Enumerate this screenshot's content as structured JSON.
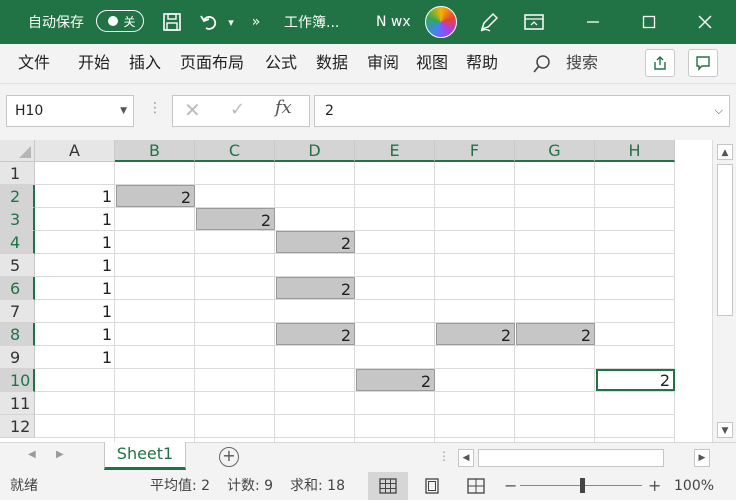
{
  "titlebar": {
    "autosave_label": "自动保存",
    "autosave_state": "关",
    "more_commands": "»",
    "doc_title": "工作簿...",
    "user_name": "N wx"
  },
  "menu": {
    "items": [
      "文件",
      "开始",
      "插入",
      "页面布局",
      "公式",
      "数据",
      "审阅",
      "视图",
      "帮助"
    ],
    "search_label": "搜索"
  },
  "formula_bar": {
    "name_box": "H10",
    "fx_label": "fx",
    "formula": "2"
  },
  "grid": {
    "columns": [
      "A",
      "B",
      "C",
      "D",
      "E",
      "F",
      "G",
      "H"
    ],
    "rows": [
      "1",
      "2",
      "3",
      "4",
      "5",
      "6",
      "7",
      "8",
      "9",
      "10",
      "11",
      "12"
    ],
    "active_cell": "H10",
    "cells": [
      {
        "ref": "A2",
        "value": "1"
      },
      {
        "ref": "A3",
        "value": "1"
      },
      {
        "ref": "A4",
        "value": "1"
      },
      {
        "ref": "A5",
        "value": "1"
      },
      {
        "ref": "A6",
        "value": "1"
      },
      {
        "ref": "A7",
        "value": "1"
      },
      {
        "ref": "A8",
        "value": "1"
      },
      {
        "ref": "A9",
        "value": "1"
      },
      {
        "ref": "B2",
        "value": "2",
        "highlight": true
      },
      {
        "ref": "C3",
        "value": "2",
        "highlight": true
      },
      {
        "ref": "D4",
        "value": "2",
        "highlight": true
      },
      {
        "ref": "D6",
        "value": "2",
        "highlight": true
      },
      {
        "ref": "D8",
        "value": "2",
        "highlight": true
      },
      {
        "ref": "F8",
        "value": "2",
        "highlight": true
      },
      {
        "ref": "G8",
        "value": "2",
        "highlight": true
      },
      {
        "ref": "E10",
        "value": "2",
        "highlight": true
      },
      {
        "ref": "H10",
        "value": "2",
        "active": true
      }
    ]
  },
  "sheets": {
    "tabs": [
      "Sheet1"
    ],
    "add_label": "+"
  },
  "statusbar": {
    "ready": "就绪",
    "average": "平均值: 2",
    "count": "计数: 9",
    "sum": "求和: 18",
    "zoom_minus": "−",
    "zoom_plus": "+",
    "zoom": "100%"
  },
  "colors": {
    "accent": "#217346",
    "highlight_fill": "#c6c6c6"
  }
}
